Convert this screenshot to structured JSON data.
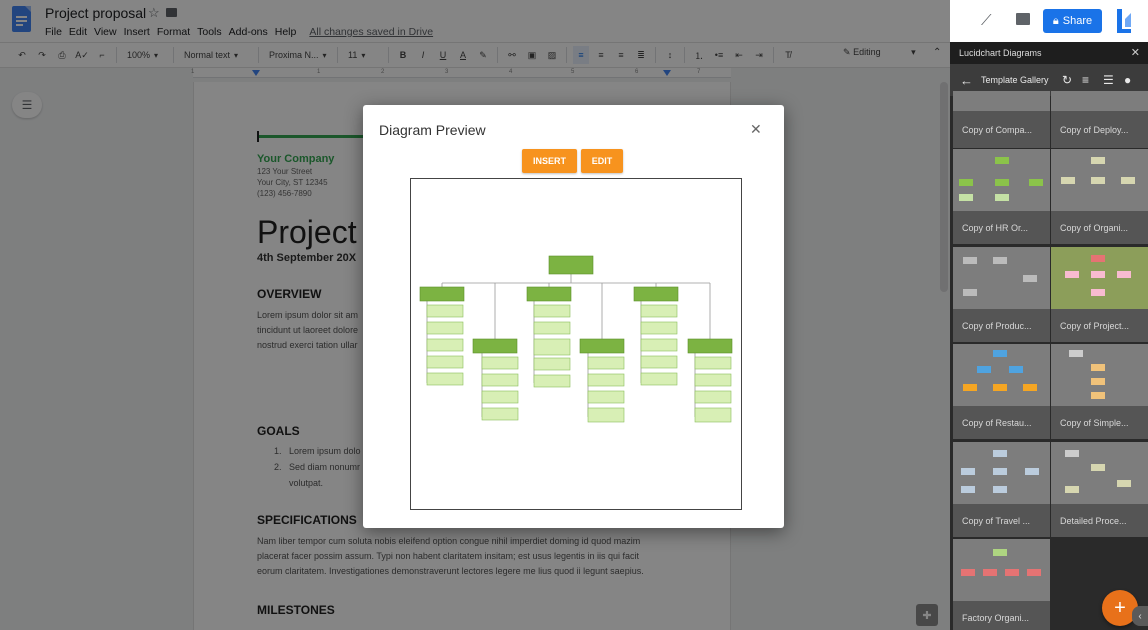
{
  "header": {
    "doc_title": "Project proposal",
    "menu": [
      "File",
      "Edit",
      "View",
      "Insert",
      "Format",
      "Tools",
      "Add-ons",
      "Help"
    ],
    "save_status": "All changes saved in Drive",
    "share_label": "Share"
  },
  "toolbar": {
    "zoom": "100%",
    "style": "Normal text",
    "font": "Proxima N...",
    "font_size": "11",
    "mode": "Editing"
  },
  "ruler": {
    "ticks": [
      "1",
      "1",
      "2",
      "3",
      "4",
      "5",
      "6",
      "7"
    ]
  },
  "document": {
    "company": "Your Company",
    "address_lines": [
      "123 Your Street",
      "Your City, ST 12345",
      "(123) 456-7890"
    ],
    "title": "Project",
    "date": "4th September 20X",
    "overview_heading": "OVERVIEW",
    "overview_lines": [
      "Lorem ipsum dolor sit am",
      "tincidunt ut laoreet dolore",
      "nostrud exerci tation ullar"
    ],
    "goals_heading": "GOALS",
    "goals": [
      "Lorem ipsum dolo",
      "Sed diam nonumr",
      "volutpat."
    ],
    "specs_heading": "SPECIFICATIONS",
    "specs_lines": [
      "Nam liber tempor cum soluta nobis eleifend option congue nihil imperdiet doming id quod mazim",
      "placerat facer possim assum. Typi non habent claritatem insitam; est usus legentis in iis qui facit",
      "eorum claritatem. Investigationes demonstraverunt lectores legere me lius quod ii legunt saepius."
    ],
    "milestones_heading": "MILESTONES"
  },
  "sidebar": {
    "title": "Lucidchart Diagrams",
    "nav_label": "Template Gallery",
    "templates": [
      "Copy of Compa...",
      "Copy of Deploy...",
      "Copy of HR Or...",
      "Copy of Organi...",
      "Copy of Produc...",
      "Copy of Project...",
      "Copy of Restau...",
      "Copy of Simple...",
      "Copy of Travel ...",
      "Detailed Proce...",
      "Factory Organi..."
    ]
  },
  "modal": {
    "title": "Diagram Preview",
    "insert_label": "INSERT",
    "edit_label": "EDIT"
  },
  "colors": {
    "accent_orange": "#f7931e",
    "org_dark_green": "#7cb342",
    "org_light_green": "#d8efb5",
    "share_blue": "#1a73e8"
  },
  "icons": [
    "docs-logo",
    "star-icon",
    "folder-icon",
    "activity-icon",
    "comment-icon",
    "lock-icon",
    "lucid-logo",
    "undo-icon",
    "redo-icon",
    "print-icon",
    "spellcheck-icon",
    "paint-format-icon",
    "bold-icon",
    "italic-icon",
    "underline-icon",
    "text-color-icon",
    "highlight-icon",
    "link-icon",
    "comment-add-icon",
    "image-icon",
    "align-left-icon",
    "align-center-icon",
    "align-right-icon",
    "justify-icon",
    "line-spacing-icon",
    "numbered-list-icon",
    "bullet-list-icon",
    "indent-decrease-icon",
    "indent-increase-icon",
    "clear-format-icon",
    "pencil-icon",
    "back-arrow-icon",
    "refresh-icon",
    "sort-icon",
    "list-icon",
    "account-icon",
    "close-icon",
    "plus-icon"
  ]
}
